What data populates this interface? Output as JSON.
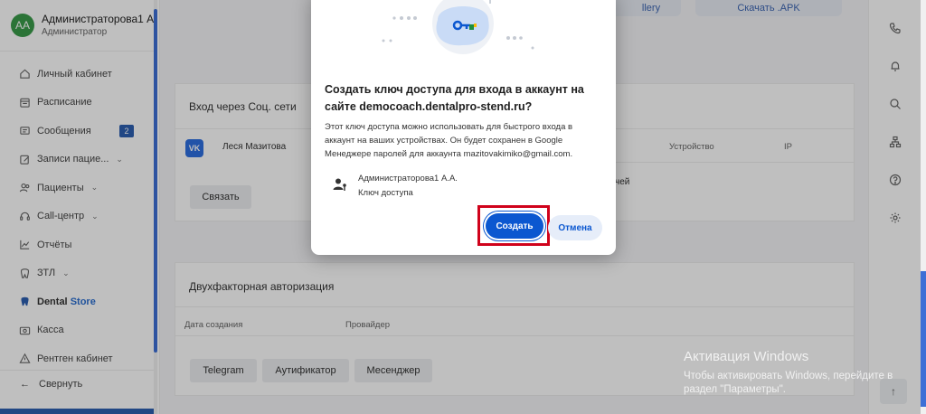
{
  "user": {
    "initials": "AA",
    "name": "Администраторова1 А",
    "role": "Администратор"
  },
  "sidebar": {
    "items": [
      {
        "label": "Личный кабинет",
        "icon": "home-icon"
      },
      {
        "label": "Расписание",
        "icon": "calendar-icon"
      },
      {
        "label": "Сообщения",
        "icon": "message-icon",
        "badge": "2"
      },
      {
        "label": "Записи пацие...",
        "icon": "edit-icon",
        "chevron": "⌄"
      },
      {
        "label": "Пациенты",
        "icon": "users-icon",
        "chevron": "⌄"
      },
      {
        "label": "Call-центр",
        "icon": "headset-icon",
        "chevron": "⌄"
      },
      {
        "label": "Отчёты",
        "icon": "chart-icon"
      },
      {
        "label": "ЗТЛ",
        "icon": "tooth-icon",
        "chevron": "⌄"
      },
      {
        "label": "Dental",
        "label2": "Store",
        "icon": "tooth-filled-icon"
      },
      {
        "label": "Касса",
        "icon": "cashbox-icon"
      },
      {
        "label": "Рентген кабинет",
        "icon": "xray-icon"
      }
    ],
    "collapse_label": "Свернуть"
  },
  "main": {
    "top_buttons": {
      "gallery": "llery",
      "apk": "Скачать .APK"
    },
    "social": {
      "title": "Вход через Соц. сети",
      "vk_label": "VK",
      "account_name": "Леся Мазитова",
      "link_button": "Связать",
      "col_device": "Устройство",
      "col_ip": "IP",
      "partial_text": "чей"
    },
    "twofa": {
      "title": "Двухфакторная авторизация",
      "col_date": "Дата создания",
      "col_provider": "Провайдер",
      "buttons": [
        "Telegram",
        "Аутификатор",
        "Месенджер"
      ]
    }
  },
  "dialog": {
    "title": "Создать ключ доступа для входа в аккаунт на сайте democoach.dentalpro-stend.ru?",
    "description": "Этот ключ доступа можно использовать для быстрого входа в аккаунт на ваших устройствах. Он будет сохранен в Google Менеджере паролей для аккаунта mazitovakimiko@gmail.com.",
    "account_name": "Администраторова1 А.А.",
    "account_sub": "Ключ доступа",
    "create_button": "Создать",
    "cancel_button": "Отмена"
  },
  "watermark": {
    "title": "Активация Windows",
    "subtitle": "Чтобы активировать Windows, перейдите в раздел \"Параметры\"."
  },
  "colors": {
    "accent": "#0b57d0",
    "highlight": "#d0021b",
    "brand": "#2d5fb0"
  }
}
